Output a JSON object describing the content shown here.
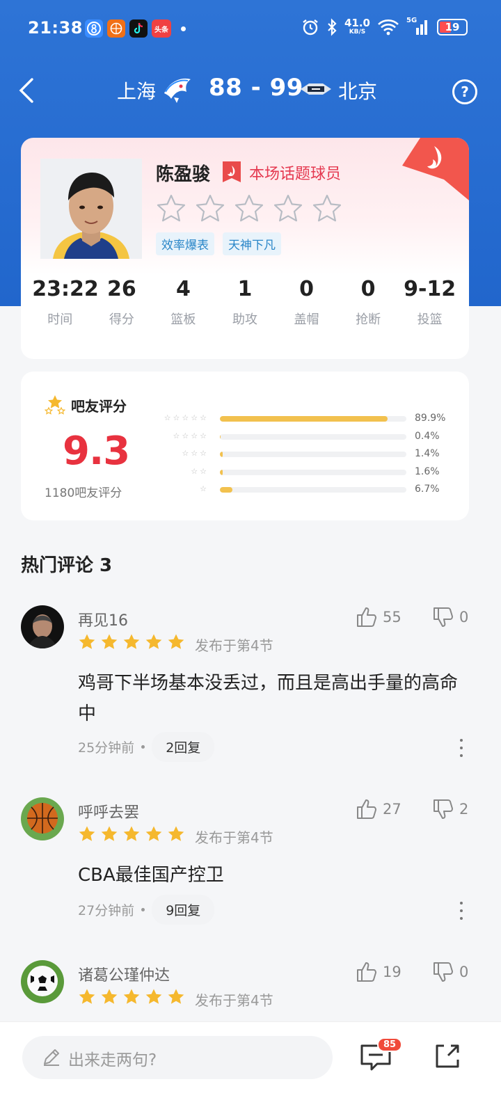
{
  "status_bar": {
    "time": "21:38",
    "network_speed_value": "41.0",
    "network_speed_unit": "KB/S",
    "cellular": "5G",
    "battery": "19",
    "app_icons": [
      "app-8-icon",
      "basketball-app-icon",
      "tiktok-icon",
      "toutiao-icon"
    ],
    "toutiao_label": "头条"
  },
  "header": {
    "team_home": "上海",
    "score": "88 - 99",
    "team_away": "北京",
    "help": "?"
  },
  "player": {
    "name": "陈盈骏",
    "topic_label": "本场话题球员",
    "tags": [
      "效率爆表",
      "天神下凡"
    ],
    "rating_stars_total": 5,
    "stats": [
      {
        "value": "23:22",
        "label": "时间"
      },
      {
        "value": "26",
        "label": "得分"
      },
      {
        "value": "4",
        "label": "篮板"
      },
      {
        "value": "1",
        "label": "助攻"
      },
      {
        "value": "0",
        "label": "盖帽"
      },
      {
        "value": "0",
        "label": "抢断"
      },
      {
        "value": "9-12",
        "label": "投篮"
      }
    ]
  },
  "rating": {
    "title": "吧友评分",
    "score": "9.3",
    "count_label": "1180吧友评分",
    "distribution": [
      {
        "stars": "☆☆☆☆☆",
        "percent": "89.9%",
        "fraction": 0.899
      },
      {
        "stars": "☆☆☆☆",
        "percent": "0.4%",
        "fraction": 0.004
      },
      {
        "stars": "☆☆☆",
        "percent": "1.4%",
        "fraction": 0.014
      },
      {
        "stars": "☆☆",
        "percent": "1.6%",
        "fraction": 0.016
      },
      {
        "stars": "☆",
        "percent": "6.7%",
        "fraction": 0.067
      }
    ]
  },
  "comments_section": {
    "title": "热门评论 3",
    "comments": [
      {
        "user": "再见16",
        "rating": 5,
        "section": "发布于第4节",
        "text": "鸡哥下半场基本没丢过，而且是高出手量的高命中",
        "time": "25分钟前",
        "replies": "2回复",
        "likes": "55",
        "dislikes": "0"
      },
      {
        "user": "呼呼去罢",
        "rating": 5,
        "section": "发布于第4节",
        "text": "CBA最佳国产控卫",
        "time": "27分钟前",
        "replies": "9回复",
        "likes": "27",
        "dislikes": "2"
      },
      {
        "user": "诸葛公瑾仲达",
        "rating": 5,
        "section": "发布于第4节",
        "text": "",
        "time": "",
        "replies": "",
        "likes": "19",
        "dislikes": "0"
      }
    ]
  },
  "bottom_bar": {
    "input_placeholder": "出来走两句?",
    "message_badge": "85"
  },
  "colors": {
    "header_blue": "#2166cc",
    "accent_red": "#e8323f",
    "star_gold": "#f5b82e",
    "tag_blue": "#2a86c8"
  }
}
